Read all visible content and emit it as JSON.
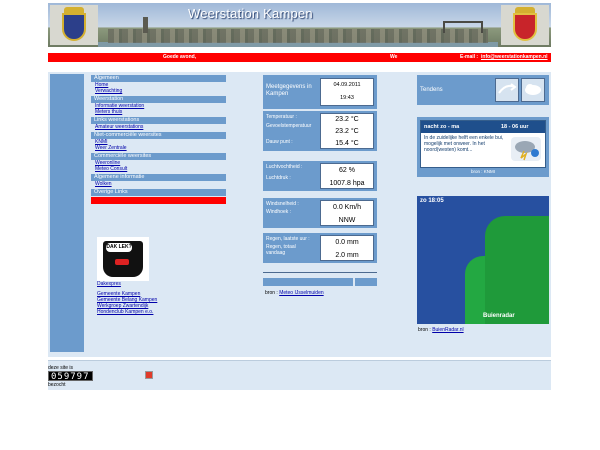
{
  "banner": {
    "title": "Weerstation Kampen"
  },
  "topbar": {
    "greeting": "Goede avond,",
    "message": "We",
    "email_label": "E-mail :",
    "email": "info@weerstationkampen.nl"
  },
  "menu": {
    "sections": [
      {
        "head": "Algemeen",
        "links": [
          "Home",
          "Verwachting"
        ]
      },
      {
        "head": "Weerstation",
        "links": [
          "Informatie weerstation",
          "Meters thuis"
        ]
      },
      {
        "head": "Links weerstations",
        "links": [
          "Amateur weerstations"
        ]
      },
      {
        "head": "Niet-commerciële weersites",
        "links": [
          "KNMI",
          "Weer Zentrale"
        ]
      },
      {
        "head": "Commerciële weersites",
        "links": [
          "Weeronline",
          "Meteo Consult"
        ]
      },
      {
        "head": "Algemene informatie",
        "links": [
          "Wolken"
        ]
      },
      {
        "head": "Overige Links",
        "links": []
      }
    ],
    "promo_caption": "Dakexpres",
    "promo_bubble": "DAK LEK?",
    "extra_links": [
      "Gemeente Kampen",
      "Gemeente Belang Kampen",
      "Werkgroep Zwartendijk",
      "Hondenclub Kampen e.o."
    ]
  },
  "weather": {
    "header": "Meetgegevens in Kampen",
    "date": "04.09.2011",
    "time": "19:43",
    "temperature_label": "Temperatuur :",
    "temperature": "23.2 °C",
    "feels_label": "Gevoelstemperatuur",
    "feels": "23.2 °C",
    "dew_label": "Dauw punt :",
    "dew": "15.4 °C",
    "humidity_label": "Luchtvochtheid :",
    "humidity": "62 %",
    "pressure_label": "Luchtdruk :",
    "pressure": "1007.8 hpa",
    "wind_speed_label": "Windsnelheid :",
    "wind_speed": "0.0 Km/h",
    "wind_dir_label": "Windhoek :",
    "wind_dir": "NNW",
    "rain_last_label": "Regen, laatste uur :",
    "rain_last": "0.0 mm",
    "rain_today_label": "Regen, totaal vandaag",
    "rain_today": "2.0 mm",
    "source_label": "bron :",
    "source_link": "Meteo IJsselmuiden"
  },
  "right": {
    "trend_label": "Tendens",
    "forecast_title_left": "nacht zo - ma",
    "forecast_title_right": "18 - 06 uur",
    "forecast_text": "In de zuidelijke helft een enkele bui, mogelijk met onweer. In het noord(westen) komt...",
    "forecast_source": "bron : KNMI",
    "radar_time": "zo 18:05",
    "radar_brand": "Buienradar",
    "radar_source_label": "bron :",
    "radar_source_link": "BuienRadar.nl"
  },
  "footer": {
    "counter_label": "deze site is",
    "counter": "059797",
    "counter_suffix": "bezocht"
  },
  "colors": {
    "accent": "#6c9bcc",
    "red": "#ff0000",
    "background": "#dce8f4"
  }
}
